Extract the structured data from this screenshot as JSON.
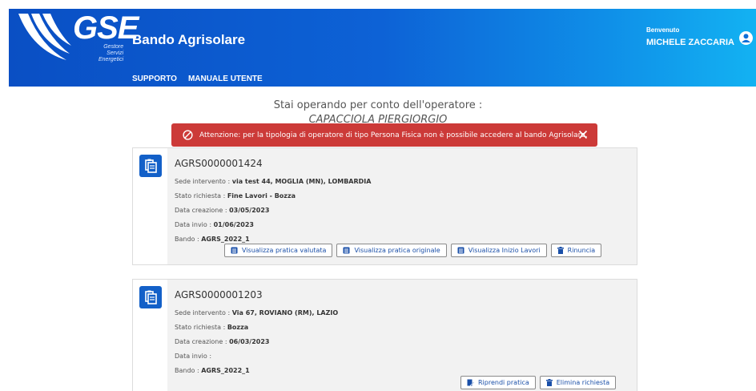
{
  "brand": {
    "logo_text": "GSE",
    "logo_sub_line1": "Gestore",
    "logo_sub_line2": "Servizi",
    "logo_sub_line3": "Energetici"
  },
  "header": {
    "app_title": "Bando Agrisolare",
    "nav": [
      "SUPPORTO",
      "MANUALE UTENTE"
    ],
    "welcome_label": "Benvenuto",
    "user_name": "MICHELE ZACCARIA"
  },
  "operator": {
    "intro": "Stai operando per conto dell'operatore :",
    "name": "CAPACCIOLA PIERGIORGIO"
  },
  "alert": {
    "message": "Attenzione: per la tipologia di operatore di tipo Persona Fisica non è possibile accedere al bando Agrisolare."
  },
  "colors": {
    "header_start": "#0a4fc4",
    "header_end": "#13b2f2",
    "alert_bg": "#cc3a38",
    "icon_blue": "#1360c8"
  },
  "cards": [
    {
      "code": "AGRS0000001424",
      "sede_label": "Sede intervento : ",
      "sede_value": "via test 44, MOGLIA (MN), LOMBARDIA",
      "stato_label": "Stato richiesta : ",
      "stato_value": "Fine Lavori - Bozza",
      "creazione_label": "Data creazione : ",
      "creazione_value": "03/05/2023",
      "invio_label": "Data invio : ",
      "invio_value": "01/06/2023",
      "bando_label": "Bando : ",
      "bando_value": "AGRS_2022_1",
      "buttons": [
        "Visualizza pratica valutata",
        "Visualizza pratica originale",
        "Visualizza Inizio Lavori",
        "Rinuncia"
      ]
    },
    {
      "code": "AGRS0000001203",
      "sede_label": "Sede intervento : ",
      "sede_value": "Via 67, ROVIANO (RM), LAZIO",
      "stato_label": "Stato richiesta : ",
      "stato_value": "Bozza",
      "creazione_label": "Data creazione : ",
      "creazione_value": "06/03/2023",
      "invio_label": "Data invio : ",
      "invio_value": "",
      "bando_label": "Bando : ",
      "bando_value": "AGRS_2022_1",
      "buttons": [
        "Riprendi pratica",
        "Elimina richiesta"
      ]
    }
  ]
}
